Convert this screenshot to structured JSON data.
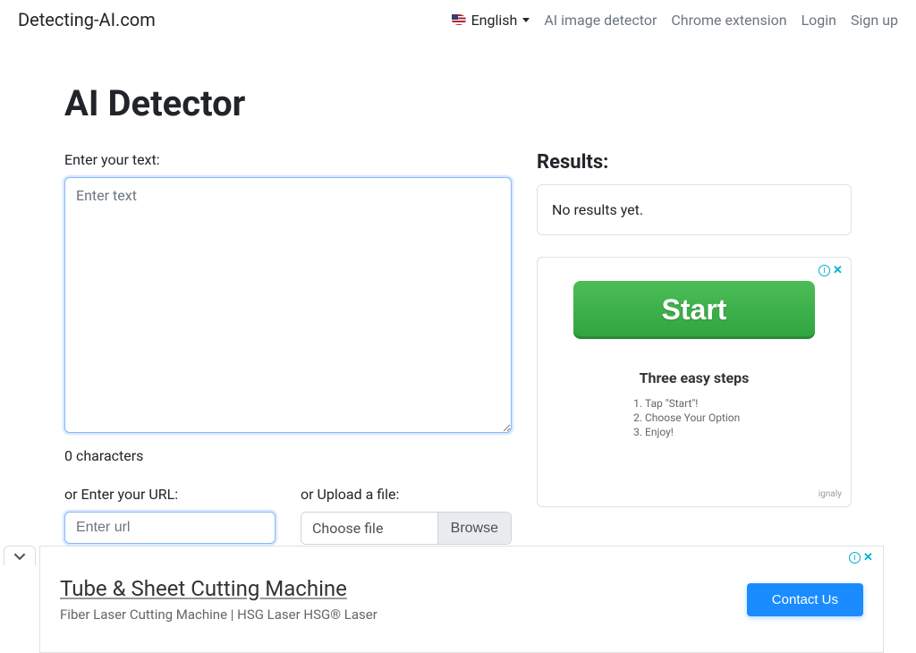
{
  "brand": "Detecting-AI.com",
  "lang": {
    "label": "English"
  },
  "nav": {
    "ai_image_detector": "AI image detector",
    "chrome_extension": "Chrome extension",
    "login": "Login",
    "signup": "Sign up"
  },
  "page": {
    "title": "AI Detector",
    "text_label": "Enter your text:",
    "textarea_placeholder": "Enter text",
    "char_count": "0 characters",
    "url_label": "or Enter your URL:",
    "url_placeholder": "Enter url",
    "file_label": "or Upload a file:",
    "file_choose": "Choose file",
    "file_browse": "Browse"
  },
  "results": {
    "title": "Results:",
    "body": "No results yet."
  },
  "side_ad": {
    "start": "Start",
    "subtitle": "Three easy steps",
    "steps": [
      "Tap \"Start\"!",
      "Choose Your Option",
      "Enjoy!"
    ],
    "brand": "ignaly"
  },
  "bottom_ad": {
    "title": "Tube & Sheet Cutting Machine",
    "subtitle": "Fiber Laser Cutting Machine | HSG Laser HSG® Laser",
    "cta": "Contact Us"
  }
}
